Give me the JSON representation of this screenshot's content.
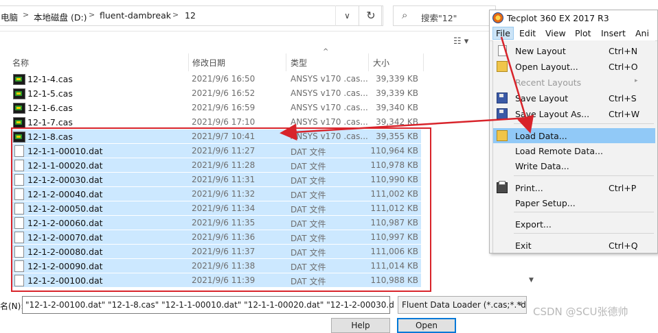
{
  "address": {
    "crumbs": [
      "电脑",
      "本地磁盘 (D:)",
      "fluent-dambreak",
      "12"
    ],
    "separator": ">",
    "dropdown_glyph": "∨",
    "refresh_glyph": "↻"
  },
  "search": {
    "placeholder": "搜索\"12\"",
    "icon": "search-icon"
  },
  "columns": {
    "name": "名称",
    "date": "修改日期",
    "type": "类型",
    "size": "大小",
    "sort_glyph": "^"
  },
  "view_glyph": "☷ ▾",
  "files": [
    {
      "name": "12-1-4.cas",
      "date": "2021/9/6 16:50",
      "type": "ANSYS v170 .cas...",
      "size": "39,339 KB",
      "kind": "cas",
      "selected": false
    },
    {
      "name": "12-1-5.cas",
      "date": "2021/9/6 16:52",
      "type": "ANSYS v170 .cas...",
      "size": "39,339 KB",
      "kind": "cas",
      "selected": false
    },
    {
      "name": "12-1-6.cas",
      "date": "2021/9/6 16:59",
      "type": "ANSYS v170 .cas...",
      "size": "39,340 KB",
      "kind": "cas",
      "selected": false
    },
    {
      "name": "12-1-7.cas",
      "date": "2021/9/6 17:10",
      "type": "ANSYS v170 .cas...",
      "size": "39,342 KB",
      "kind": "cas",
      "selected": false
    },
    {
      "name": "12-1-8.cas",
      "date": "2021/9/7 10:41",
      "type": "ANSYS v170 .cas...",
      "size": "39,355 KB",
      "kind": "cas",
      "selected": true
    },
    {
      "name": "12-1-1-00010.dat",
      "date": "2021/9/6 11:27",
      "type": "DAT 文件",
      "size": "110,964 KB",
      "kind": "dat",
      "selected": true
    },
    {
      "name": "12-1-1-00020.dat",
      "date": "2021/9/6 11:28",
      "type": "DAT 文件",
      "size": "110,978 KB",
      "kind": "dat",
      "selected": true
    },
    {
      "name": "12-1-2-00030.dat",
      "date": "2021/9/6 11:31",
      "type": "DAT 文件",
      "size": "110,990 KB",
      "kind": "dat",
      "selected": true
    },
    {
      "name": "12-1-2-00040.dat",
      "date": "2021/9/6 11:32",
      "type": "DAT 文件",
      "size": "111,002 KB",
      "kind": "dat",
      "selected": true
    },
    {
      "name": "12-1-2-00050.dat",
      "date": "2021/9/6 11:34",
      "type": "DAT 文件",
      "size": "111,012 KB",
      "kind": "dat",
      "selected": true
    },
    {
      "name": "12-1-2-00060.dat",
      "date": "2021/9/6 11:35",
      "type": "DAT 文件",
      "size": "110,987 KB",
      "kind": "dat",
      "selected": true
    },
    {
      "name": "12-1-2-00070.dat",
      "date": "2021/9/6 11:36",
      "type": "DAT 文件",
      "size": "110,997 KB",
      "kind": "dat",
      "selected": true
    },
    {
      "name": "12-1-2-00080.dat",
      "date": "2021/9/6 11:37",
      "type": "DAT 文件",
      "size": "111,006 KB",
      "kind": "dat",
      "selected": true
    },
    {
      "name": "12-1-2-00090.dat",
      "date": "2021/9/6 11:38",
      "type": "DAT 文件",
      "size": "111,014 KB",
      "kind": "dat",
      "selected": true
    },
    {
      "name": "12-1-2-00100.dat",
      "date": "2021/9/6 11:39",
      "type": "DAT 文件",
      "size": "110,988 KB",
      "kind": "dat",
      "selected": true
    }
  ],
  "footer": {
    "filename_label": "名(N):",
    "filename_value": "\"12-1-2-00100.dat\" \"12-1-8.cas\" \"12-1-1-00010.dat\" \"12-1-1-00020.dat\" \"12-1-2-00030.d",
    "filetype_value": "Fluent Data Loader (*.cas;*.*d",
    "filetype_glyph": "∨",
    "help_label": "Help",
    "open_label": "Open"
  },
  "tecplot": {
    "title": "Tecplot 360 EX 2017 R3",
    "menus": [
      "File",
      "Edit",
      "View",
      "Plot",
      "Insert",
      "Ani"
    ],
    "items": [
      {
        "label": "New Layout",
        "shortcut": "Ctrl+N",
        "icon": "new-file-icon",
        "disabled": false,
        "submenu": false,
        "highlight": false
      },
      {
        "label": "Open Layout...",
        "shortcut": "Ctrl+O",
        "icon": "open-folder-icon",
        "disabled": false,
        "submenu": false,
        "highlight": false
      },
      {
        "label": "Recent Layouts",
        "shortcut": "",
        "icon": "",
        "disabled": true,
        "submenu": true,
        "highlight": false
      },
      {
        "label": "Save Layout",
        "shortcut": "Ctrl+S",
        "icon": "save-icon",
        "disabled": false,
        "submenu": false,
        "highlight": false
      },
      {
        "label": "Save Layout As...",
        "shortcut": "Ctrl+W",
        "icon": "save-icon",
        "disabled": false,
        "submenu": false,
        "highlight": false
      },
      {
        "label": "Load Data...",
        "shortcut": "",
        "icon": "load-data-icon",
        "disabled": false,
        "submenu": false,
        "highlight": true
      },
      {
        "label": "Load Remote Data...",
        "shortcut": "",
        "icon": "",
        "disabled": false,
        "submenu": false,
        "highlight": false
      },
      {
        "label": "Write Data...",
        "shortcut": "",
        "icon": "",
        "disabled": false,
        "submenu": false,
        "highlight": false
      },
      {
        "label": "Print...",
        "shortcut": "Ctrl+P",
        "icon": "print-icon",
        "disabled": false,
        "submenu": false,
        "highlight": false
      },
      {
        "label": "Paper Setup...",
        "shortcut": "",
        "icon": "",
        "disabled": false,
        "submenu": false,
        "highlight": false
      },
      {
        "label": "Export...",
        "shortcut": "",
        "icon": "",
        "disabled": false,
        "submenu": false,
        "highlight": false
      },
      {
        "label": "Exit",
        "shortcut": "Ctrl+Q",
        "icon": "",
        "disabled": false,
        "submenu": false,
        "highlight": false
      }
    ],
    "submenu_glyph": "▸"
  },
  "watermark": "CSDN @SCU张德帅",
  "colors": {
    "selection": "#cce8ff",
    "annotation_red": "#d8232a",
    "menu_highlight": "#91c9f7"
  }
}
